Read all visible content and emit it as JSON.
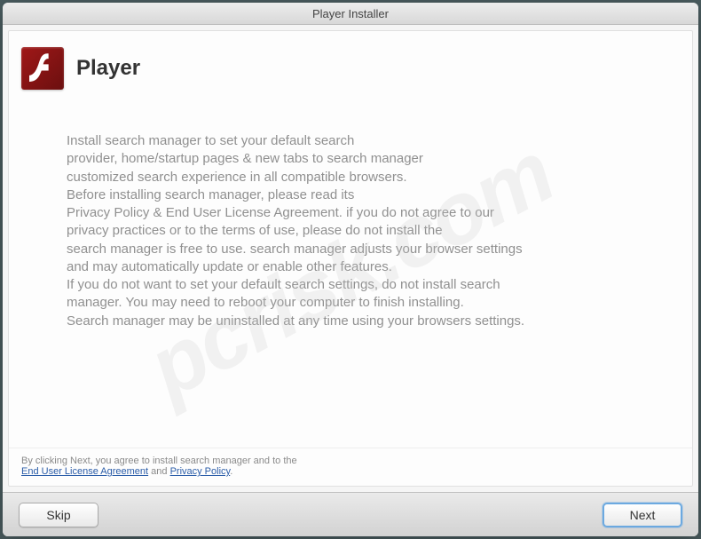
{
  "window": {
    "title": "Player Installer"
  },
  "header": {
    "title": "Player",
    "icon": "flash-icon"
  },
  "body": {
    "text": "Install search manager to set your default search\nprovider, home/startup pages & new tabs to search manager\ncustomized search experience in all compatible browsers.\nBefore installing search manager, please read its\nPrivacy Policy & End User License Agreement. if you do not agree to our\nprivacy practices or to the terms of use, please do not install the\nsearch manager is free to use. search manager adjusts your browser settings\nand may automatically update or enable other features.\nIf you do not want to set your default search settings, do not install search\nmanager. You may need to reboot your computer to finish installing.\nSearch manager may be uninstalled at any time using your browsers settings."
  },
  "footer": {
    "prefix": "By clicking Next, you agree to install search manager and to the",
    "eula_label": "End User License Agreement",
    "and": " and ",
    "privacy_label": "Privacy Policy",
    "suffix": "."
  },
  "buttons": {
    "skip": "Skip",
    "next": "Next"
  },
  "watermark": "pcrisk.com"
}
